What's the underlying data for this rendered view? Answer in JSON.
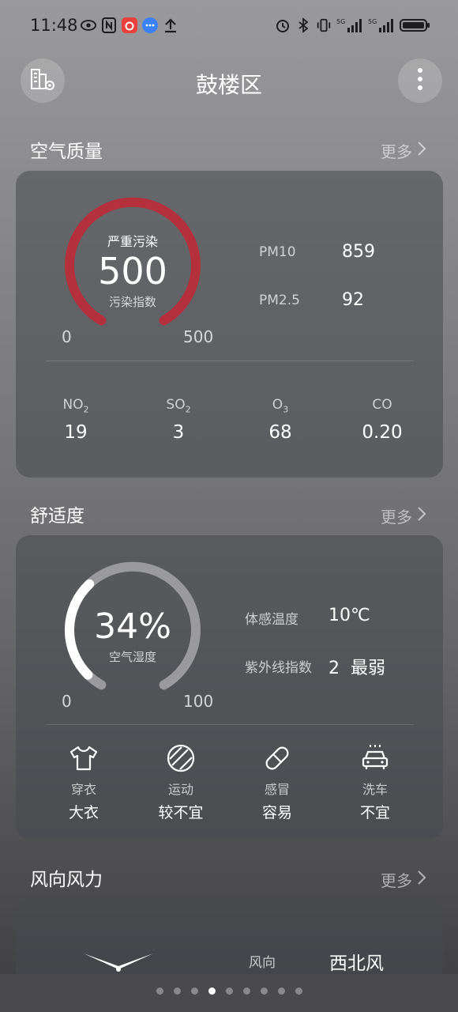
{
  "status_bar": {
    "time": "11:48",
    "left_icons": [
      "eye-icon",
      "nfc-icon",
      "netease-music-icon",
      "message-icon",
      "upload-icon"
    ],
    "right_icons": [
      "alarm-icon",
      "bluetooth-icon",
      "vibrate-icon",
      "signal-5g-icon",
      "signal-5g-icon",
      "battery-icon"
    ],
    "signal_label": "5G"
  },
  "header": {
    "title": "鼓楼区"
  },
  "air_quality": {
    "section_title": "空气质量",
    "more_label": "更多",
    "gauge": {
      "status": "严重污染",
      "value": "500",
      "caption": "污染指数",
      "min_label": "0",
      "max_label": "500",
      "fraction": 1.0
    },
    "metrics": [
      {
        "label": "PM10",
        "value": "859"
      },
      {
        "label": "PM2.5",
        "value": "92"
      }
    ],
    "pollutants": [
      {
        "name": "NO",
        "sub": "2",
        "value": "19"
      },
      {
        "name": "SO",
        "sub": "2",
        "value": "3"
      },
      {
        "name": "O",
        "sub": "3",
        "value": "68"
      },
      {
        "name": "CO",
        "sub": "",
        "value": "0.20"
      }
    ]
  },
  "comfort": {
    "section_title": "舒适度",
    "more_label": "更多",
    "gauge": {
      "value": "34%",
      "caption": "空气湿度",
      "min_label": "0",
      "max_label": "100",
      "fraction": 0.34
    },
    "metrics": [
      {
        "label": "体感温度",
        "value": "10℃"
      },
      {
        "label": "紫外线指数",
        "value": "2  最弱"
      }
    ],
    "tips": [
      {
        "icon": "tshirt-icon",
        "name": "穿衣",
        "value": "大衣"
      },
      {
        "icon": "ball-icon",
        "name": "运动",
        "value": "较不宜"
      },
      {
        "icon": "pill-icon",
        "name": "感冒",
        "value": "容易"
      },
      {
        "icon": "car-wash-icon",
        "name": "洗车",
        "value": "不宜"
      }
    ]
  },
  "wind": {
    "section_title": "风向风力",
    "more_label": "更多",
    "direction_label": "风向",
    "direction_value": "西北风"
  },
  "pager": {
    "count": 9,
    "active_index": 3
  },
  "colors": {
    "pollution_red": "#b3303c",
    "humidity_track": "#9a9a9e"
  }
}
